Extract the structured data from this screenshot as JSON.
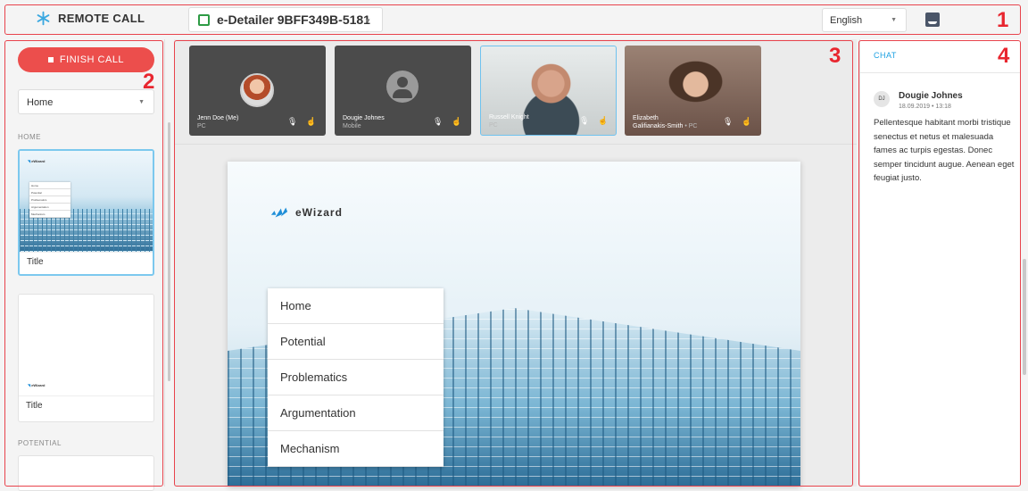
{
  "app": {
    "title": "REMOTE CALL"
  },
  "header": {
    "presentation": "e-Detailer 9BFF349B-5181",
    "language": "English",
    "callout": "1"
  },
  "sidebar": {
    "finish_label": "FINISH CALL",
    "select_value": "Home",
    "callout": "2",
    "sections": [
      {
        "label": "HOME"
      },
      {
        "label": "POTENTIAL"
      }
    ],
    "slides": [
      {
        "caption": "Title",
        "selected": true
      },
      {
        "caption": "Title",
        "selected": false
      }
    ],
    "mini": {
      "logo": "eWizard",
      "menu": [
        "Home",
        "Potential",
        "Problematics",
        "Argumentation",
        "Mechanism"
      ]
    }
  },
  "participants": [
    {
      "name": "Jenn Doe (Me)",
      "device": "PC"
    },
    {
      "name": "Dougie Johnes",
      "device": "Mobile"
    },
    {
      "name": "Russell Knight",
      "device": "PC"
    },
    {
      "name_line1": "Elizabeth",
      "name_line2": "Galifianakis-Smith",
      "device": "PC"
    }
  ],
  "center": {
    "callout": "3"
  },
  "slide": {
    "logo": "eWizard",
    "menu": [
      "Home",
      "Potential",
      "Problematics",
      "Argumentation",
      "Mechanism"
    ]
  },
  "chat": {
    "title": "CHAT",
    "callout": "4",
    "message": {
      "initials": "DJ",
      "author": "Dougie Johnes",
      "time": "18.09.2019 • 13:18",
      "text": "Pellentesque habitant morbi tristique senectus et netus et malesuada fames ac turpis egestas. Donec semper tincidunt augue. Aenean eget feugiat justo."
    }
  },
  "colors": {
    "accent": "#1da1e2",
    "danger": "#ec4e4c",
    "annotation": "#e8262f"
  }
}
